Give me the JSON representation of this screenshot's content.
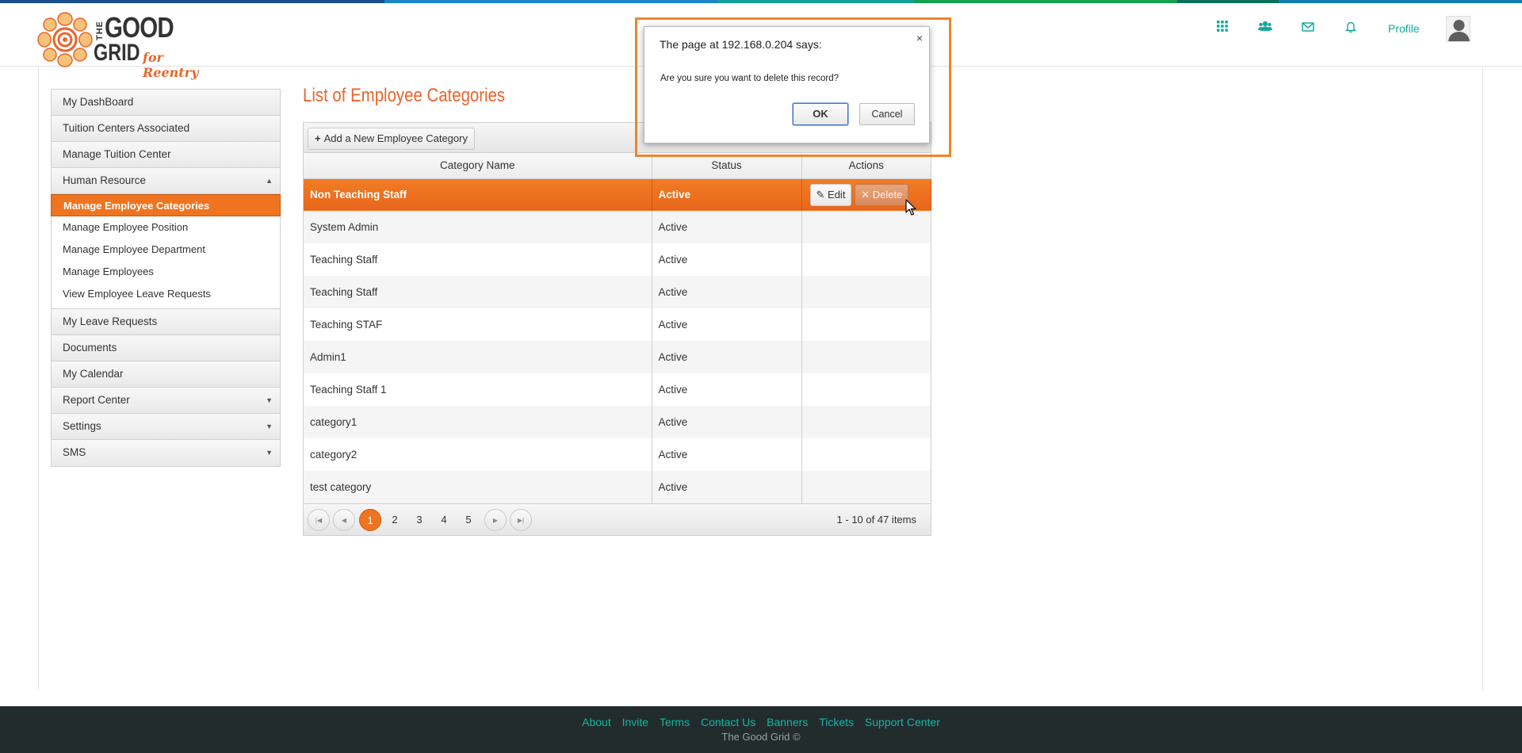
{
  "colors": {
    "accent": "#f0741f",
    "teal": "#17a89c",
    "stripe": [
      "#1a4f8b",
      "#1a86c7",
      "#149e9a",
      "#16a04f",
      "#0d6e5a",
      "#0f7fb2"
    ]
  },
  "brand": {
    "the": "THE",
    "good": "GOOD",
    "grid": "GRID",
    "tagline": "for Reentry"
  },
  "nav": {
    "icons": [
      "apps-grid-icon",
      "users-icon",
      "mail-icon",
      "bell-icon"
    ],
    "profile_label": "Profile"
  },
  "sidebar": {
    "items": [
      {
        "label": "My DashBoard"
      },
      {
        "label": "Tuition Centers Associated"
      },
      {
        "label": "Manage Tuition Center"
      },
      {
        "label": "Human Resource",
        "expanded": true
      },
      {
        "label": "My Leave Requests"
      },
      {
        "label": "Documents"
      },
      {
        "label": "My Calendar"
      },
      {
        "label": "Report Center",
        "has_submenu": true
      },
      {
        "label": "Settings",
        "has_submenu": true
      },
      {
        "label": "SMS",
        "has_submenu": true
      }
    ],
    "hr_subitems": [
      {
        "label": "Manage Employee Categories",
        "active": true
      },
      {
        "label": "Manage Employee Position"
      },
      {
        "label": "Manage Employee Department"
      },
      {
        "label": "Manage Employees"
      },
      {
        "label": "View Employee Leave Requests"
      }
    ]
  },
  "main": {
    "title": "List of Employee Categories",
    "add_button": "Add a New Employee Category",
    "columns": [
      "Category Name",
      "Status",
      "Actions"
    ],
    "rows": [
      {
        "name": "Non Teaching Staff",
        "status": "Active",
        "selected": true
      },
      {
        "name": "System Admin",
        "status": "Active"
      },
      {
        "name": "Teaching Staff",
        "status": "Active"
      },
      {
        "name": "Teaching Staff",
        "status": "Active"
      },
      {
        "name": "Teaching STAF",
        "status": "Active"
      },
      {
        "name": "Admin1",
        "status": "Active"
      },
      {
        "name": "Teaching Staff 1",
        "status": "Active"
      },
      {
        "name": "category1",
        "status": "Active"
      },
      {
        "name": "category2",
        "status": "Active"
      },
      {
        "name": "test category",
        "status": "Active"
      }
    ],
    "row_actions": {
      "edit": "Edit",
      "delete": "Delete"
    },
    "pager": {
      "pages": [
        "1",
        "2",
        "3",
        "4",
        "5"
      ],
      "current_page": "1",
      "info": "1 - 10 of 47 items"
    }
  },
  "dialog": {
    "title": "The page at 192.168.0.204 says:",
    "message": "Are you sure you want to delete this record?",
    "ok": "OK",
    "cancel": "Cancel",
    "close": "×"
  },
  "footer": {
    "links": [
      "About",
      "Invite",
      "Terms",
      "Contact Us",
      "Banners",
      "Tickets",
      "Support Center"
    ],
    "copyright": "The Good Grid ©"
  }
}
